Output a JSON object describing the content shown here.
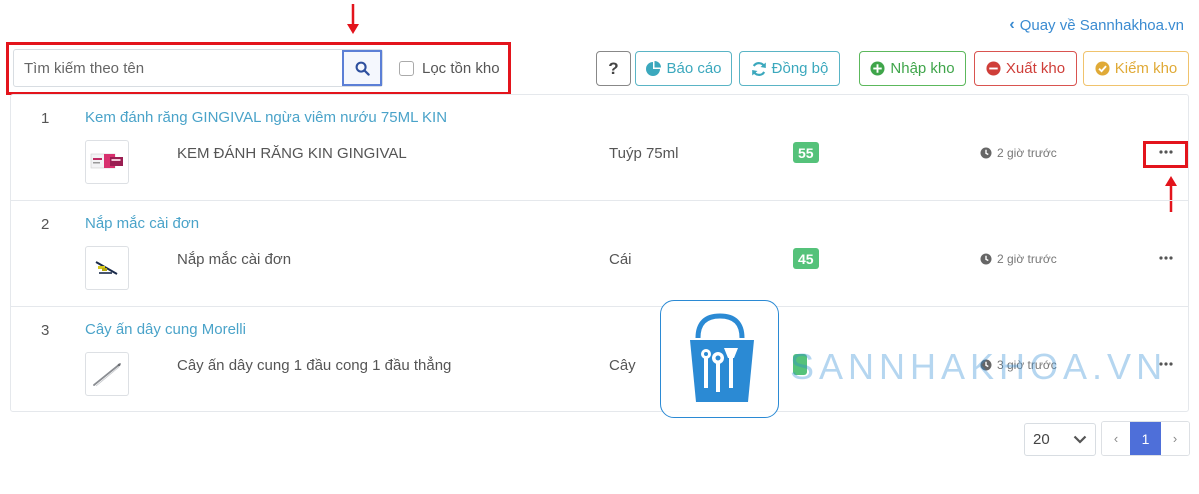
{
  "header": {
    "back_link": "Quay về Sannhakhoa.vn"
  },
  "search": {
    "placeholder": "Tìm kiếm theo tên",
    "value": ""
  },
  "filter": {
    "label": "Lọc tồn kho",
    "checked": false
  },
  "toolbar": {
    "help_label": "?",
    "report_label": "Báo cáo",
    "sync_label": "Đồng bộ",
    "import_label": "Nhập kho",
    "export_label": "Xuất kho",
    "check_label": "Kiểm kho"
  },
  "products": [
    {
      "index": "1",
      "title": "Kem đánh răng GINGIVAL ngừa viêm nướu 75ML KIN",
      "variant_name": "KEM ĐÁNH RĂNG KIN GINGIVAL",
      "unit": "Tuýp 75ml",
      "quantity": "55",
      "time": "2 giờ trước",
      "thumb_icon": "toothpaste-box-icon"
    },
    {
      "index": "2",
      "title": "Nắp mắc cài đơn",
      "variant_name": "Nắp mắc cài đơn",
      "unit": "Cái",
      "quantity": "45",
      "time": "2 giờ trước",
      "thumb_icon": "bracket-cap-icon"
    },
    {
      "index": "3",
      "title": "Cây ấn dây cung Morelli",
      "variant_name": "Cây ấn dây cung 1 đầu cong 1 đầu thẳng",
      "unit": "Cây",
      "quantity": "",
      "time": "3 giờ trước",
      "thumb_icon": "archwire-pusher-icon"
    }
  ],
  "watermark": {
    "text": "SANNHAKHOA.VN"
  },
  "pagination": {
    "page_size": "20",
    "prev": "‹",
    "current": "1",
    "next": "›"
  },
  "colors": {
    "link": "#4aa3c9",
    "badge_green": "#55c27a",
    "highlight_red": "#e3141c",
    "pager_active": "#4e6fd9"
  }
}
